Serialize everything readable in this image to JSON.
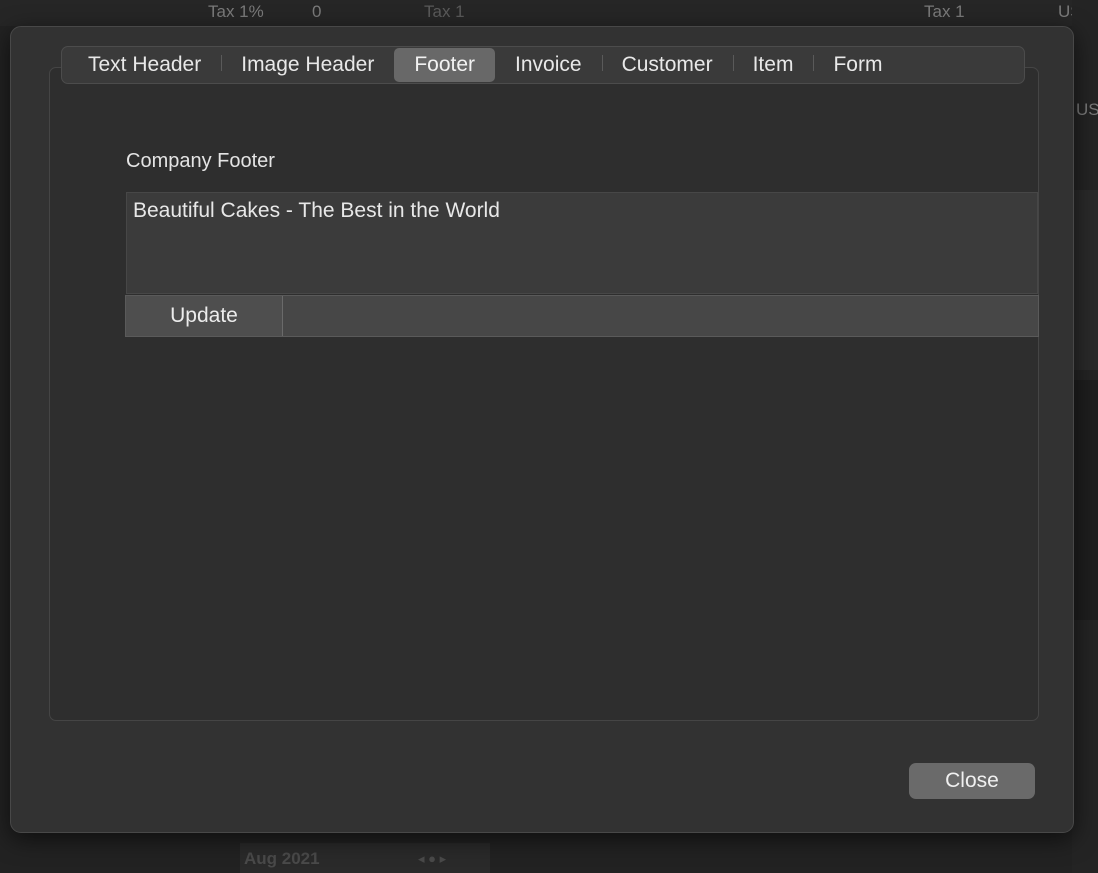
{
  "background": {
    "top_texts": [
      "Tax 1%",
      "0",
      "Tax 1",
      "Tax 1",
      "US$"
    ],
    "side_text": "US$",
    "bottom_date": "Aug 2021",
    "bottom_nav_glyphs": "◂ ● ▸"
  },
  "tabs": [
    {
      "label": "Text Header",
      "active": false
    },
    {
      "label": "Image Header",
      "active": false
    },
    {
      "label": "Footer",
      "active": true
    },
    {
      "label": "Invoice",
      "active": false
    },
    {
      "label": "Customer",
      "active": false
    },
    {
      "label": "Item",
      "active": false
    },
    {
      "label": "Form",
      "active": false
    }
  ],
  "footer_panel": {
    "section_label": "Company Footer",
    "footer_text": "Beautiful Cakes - The Best in the World",
    "update_label": "Update"
  },
  "dialog": {
    "close_label": "Close"
  }
}
